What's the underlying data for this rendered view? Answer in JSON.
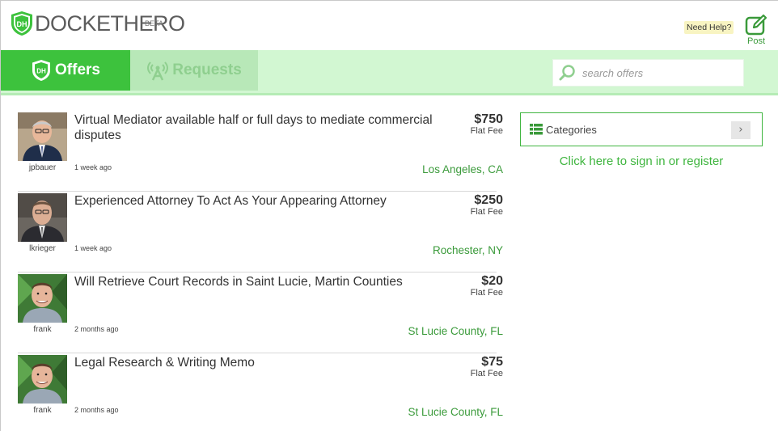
{
  "header": {
    "logo_text": "DOCKETHERO",
    "logo_mark": "DH",
    "beta_label": "BETA",
    "help_label": "Need Help?",
    "post_label": "Post",
    "post_icon": "edit-icon"
  },
  "nav": {
    "tabs": [
      {
        "label": "Offers",
        "icon": "dh-shield-icon",
        "active": true
      },
      {
        "label": "Requests",
        "icon": "antenna-icon",
        "active": false
      }
    ],
    "search": {
      "placeholder": "search offers",
      "value": "",
      "icon": "search-icon"
    }
  },
  "offers": [
    {
      "title": "Virtual Mediator available half or full days to mediate commercial disputes",
      "username": "jpbauer",
      "posted": "1 week ago",
      "price": "$750",
      "fee_type": "Flat Fee",
      "location": "Los Angeles, CA"
    },
    {
      "title": "Experienced Attorney To Act As Your Appearing Attorney",
      "username": "lkrieger",
      "posted": "1 week ago",
      "price": "$250",
      "fee_type": "Flat Fee",
      "location": "Rochester, NY"
    },
    {
      "title": "Will Retrieve Court Records in Saint Lucie, Martin Counties",
      "username": "frank",
      "posted": "2 months ago",
      "price": "$20",
      "fee_type": "Flat Fee",
      "location": "St Lucie County, FL"
    },
    {
      "title": "Legal Research & Writing Memo",
      "username": "frank",
      "posted": "2 months ago",
      "price": "$75",
      "fee_type": "Flat Fee",
      "location": "St Lucie County, FL"
    }
  ],
  "sidebar": {
    "categories_label": "Categories",
    "categories_icon": "list-icon",
    "arrow_label": "›",
    "signin_label": "Click here to sign in or register"
  },
  "colors": {
    "brand_green": "#3dc23d",
    "nav_bg": "#d2f7d2",
    "link_green": "#3a9a3a"
  }
}
